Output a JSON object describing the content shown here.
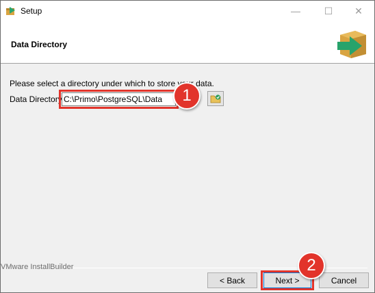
{
  "window": {
    "title": "Setup",
    "minimize_glyph": "—",
    "maximize_glyph": "☐",
    "close_glyph": "✕"
  },
  "header": {
    "title": "Data Directory",
    "graphic_icon": "installer-box-arrow-icon"
  },
  "content": {
    "prompt": "Please select a directory under which to store your data.",
    "data_directory_label": "Data Directory",
    "data_directory_value": "C:\\Primo\\PostgreSQL\\Data",
    "browse_icon": "folder-browse-icon"
  },
  "annotations": {
    "step1": "1",
    "step2": "2",
    "highlight_color": "#e2342b"
  },
  "footer": {
    "brand": "VMware InstallBuilder",
    "back_label": "< Back",
    "next_label": "Next >",
    "cancel_label": "Cancel"
  }
}
